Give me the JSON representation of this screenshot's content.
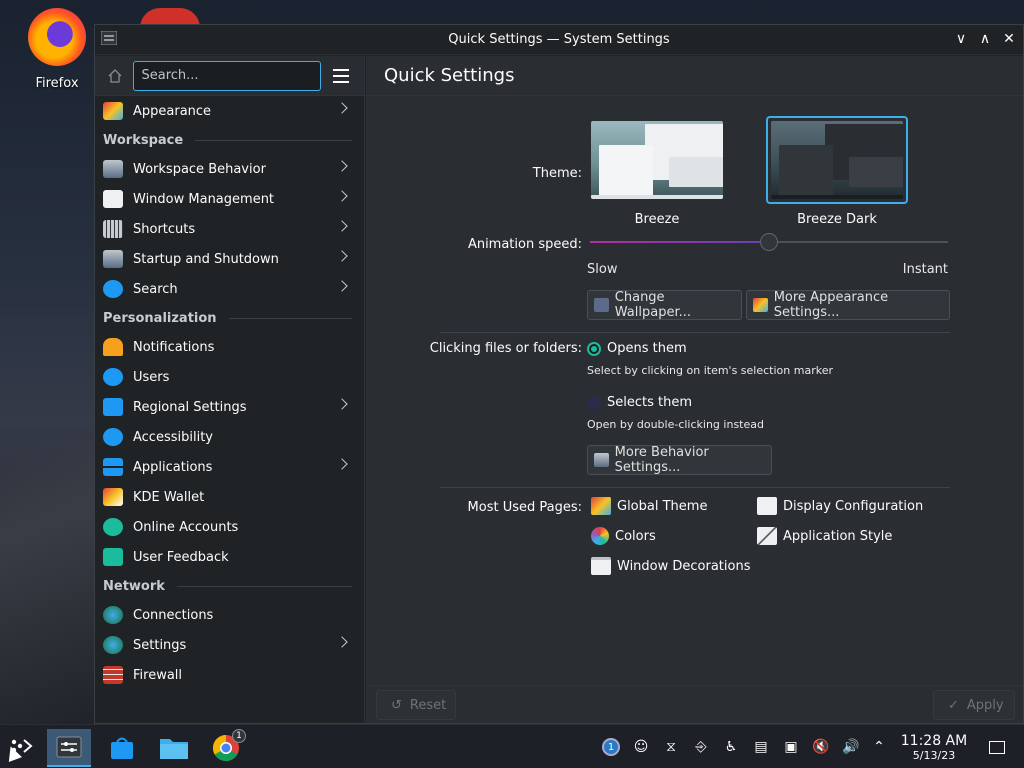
{
  "desktop": {
    "icon_label": "Firefox"
  },
  "window": {
    "title": "Quick Settings — System Settings"
  },
  "sidebar": {
    "search_placeholder": "Search...",
    "items": [
      {
        "label": "Appearance",
        "chevron": true
      },
      {
        "category": "Workspace"
      },
      {
        "label": "Workspace Behavior",
        "chevron": true
      },
      {
        "label": "Window Management",
        "chevron": true
      },
      {
        "label": "Shortcuts",
        "chevron": true
      },
      {
        "label": "Startup and Shutdown",
        "chevron": true
      },
      {
        "label": "Search",
        "chevron": true
      },
      {
        "category": "Personalization"
      },
      {
        "label": "Notifications",
        "chevron": false
      },
      {
        "label": "Users",
        "chevron": false
      },
      {
        "label": "Regional Settings",
        "chevron": true
      },
      {
        "label": "Accessibility",
        "chevron": false
      },
      {
        "label": "Applications",
        "chevron": true
      },
      {
        "label": "KDE Wallet",
        "chevron": false
      },
      {
        "label": "Online Accounts",
        "chevron": false
      },
      {
        "label": "User Feedback",
        "chevron": false
      },
      {
        "category": "Network"
      },
      {
        "label": "Connections",
        "chevron": false
      },
      {
        "label": "Settings",
        "chevron": true
      },
      {
        "label": "Firewall",
        "chevron": false
      }
    ]
  },
  "main": {
    "title": "Quick Settings",
    "theme_label": "Theme:",
    "themes": [
      {
        "name": "Breeze",
        "selected": false
      },
      {
        "name": "Breeze Dark",
        "selected": true
      }
    ],
    "animation_label": "Animation speed:",
    "animation_level": 0.5,
    "slow_label": "Slow",
    "instant_label": "Instant",
    "change_wallpaper": "Change Wallpaper...",
    "more_appearance": "More Appearance Settings...",
    "clicking_label": "Clicking files or folders:",
    "opens_them": "Opens them",
    "opens_hint": "Select by clicking on item's selection marker",
    "selects_them": "Selects them",
    "selects_hint": "Open by double-clicking instead",
    "more_behavior": "More Behavior Settings...",
    "most_used_label": "Most Used Pages:",
    "most_used": [
      "Global Theme",
      "Display Configuration",
      "Colors",
      "Application Style",
      "Window Decorations"
    ]
  },
  "footer": {
    "reset": "Reset",
    "apply": "Apply"
  },
  "taskbar": {
    "time": "11:28 AM",
    "date": "5/13/23",
    "notification_count": "1",
    "chrome_badge": "1"
  },
  "colors": {
    "accent": "#3daee9",
    "radio": "#1abc9c",
    "bg": "#202326"
  }
}
